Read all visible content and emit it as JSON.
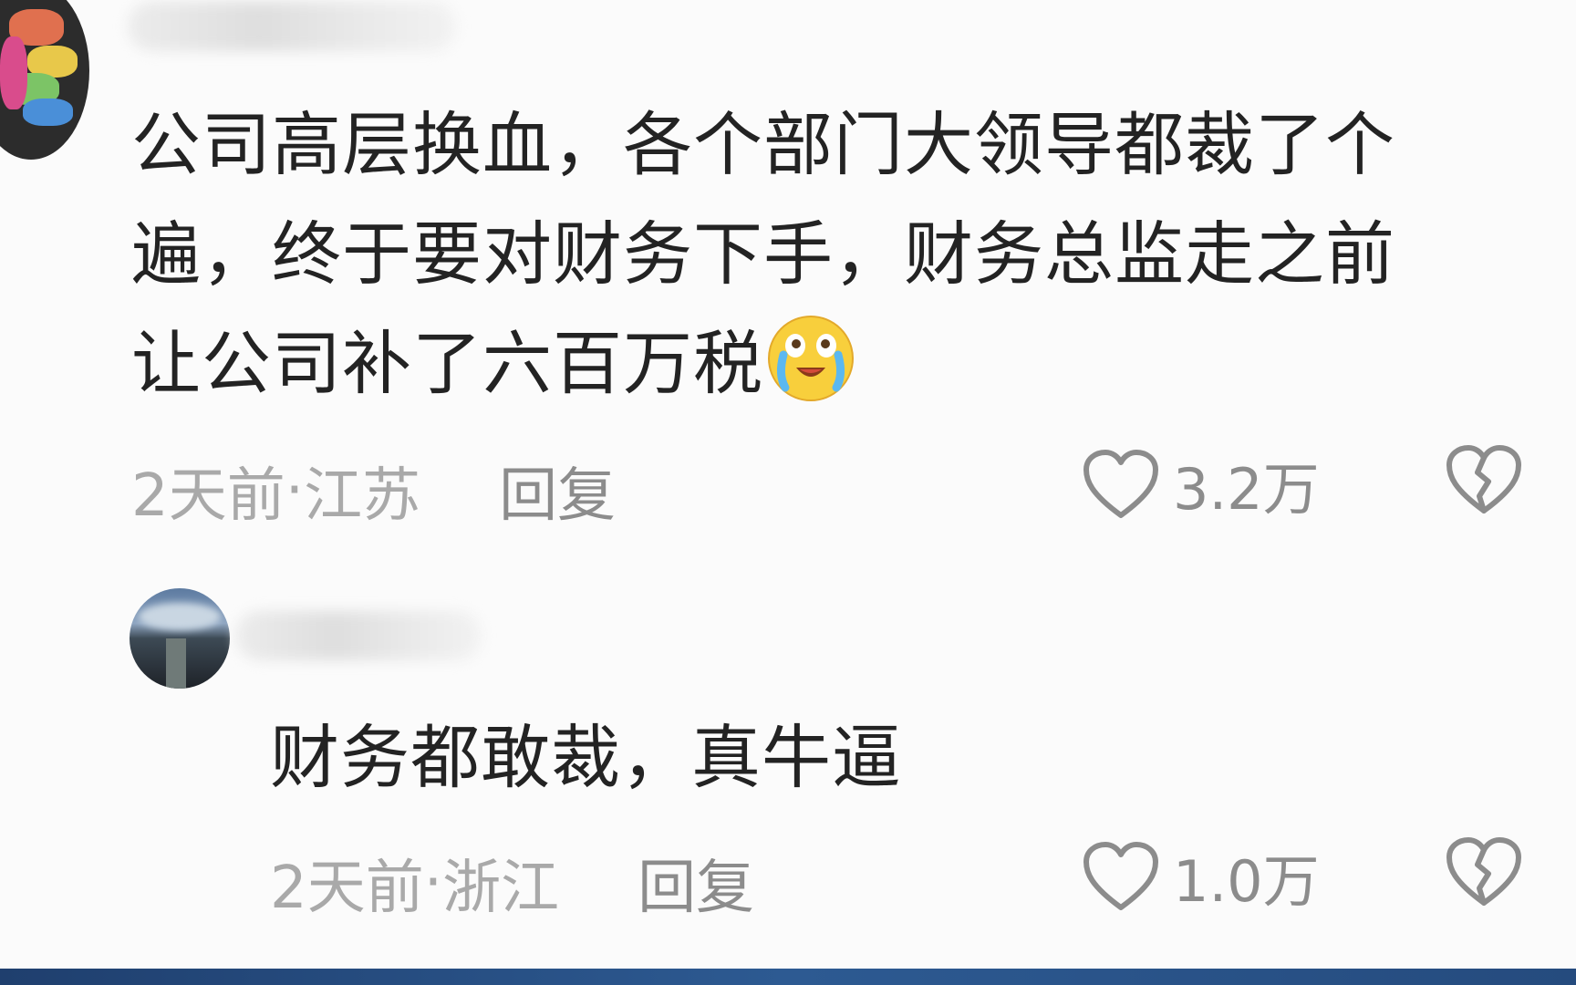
{
  "comments": [
    {
      "text_lines": [
        "公司高层换血，各个部门大领导都裁了个",
        "遍，终于要对财务下手，财务总监走之前",
        "让公司补了六百万税"
      ],
      "emoji": "crying-laughing-emoji",
      "time": "2天前",
      "location": "江苏",
      "reply_label": "回复",
      "like_count": "3.2万"
    },
    {
      "text": "财务都敢裁，真牛逼",
      "time": "2天前",
      "location": "浙江",
      "reply_label": "回复",
      "like_count": "1.0万"
    }
  ],
  "meta_separator": " · ",
  "icons": {
    "like": "heart-outline-icon",
    "dislike": "broken-heart-icon"
  },
  "colors": {
    "text": "#232323",
    "meta": "#a9a9a9",
    "icon": "#8c8c8c"
  }
}
